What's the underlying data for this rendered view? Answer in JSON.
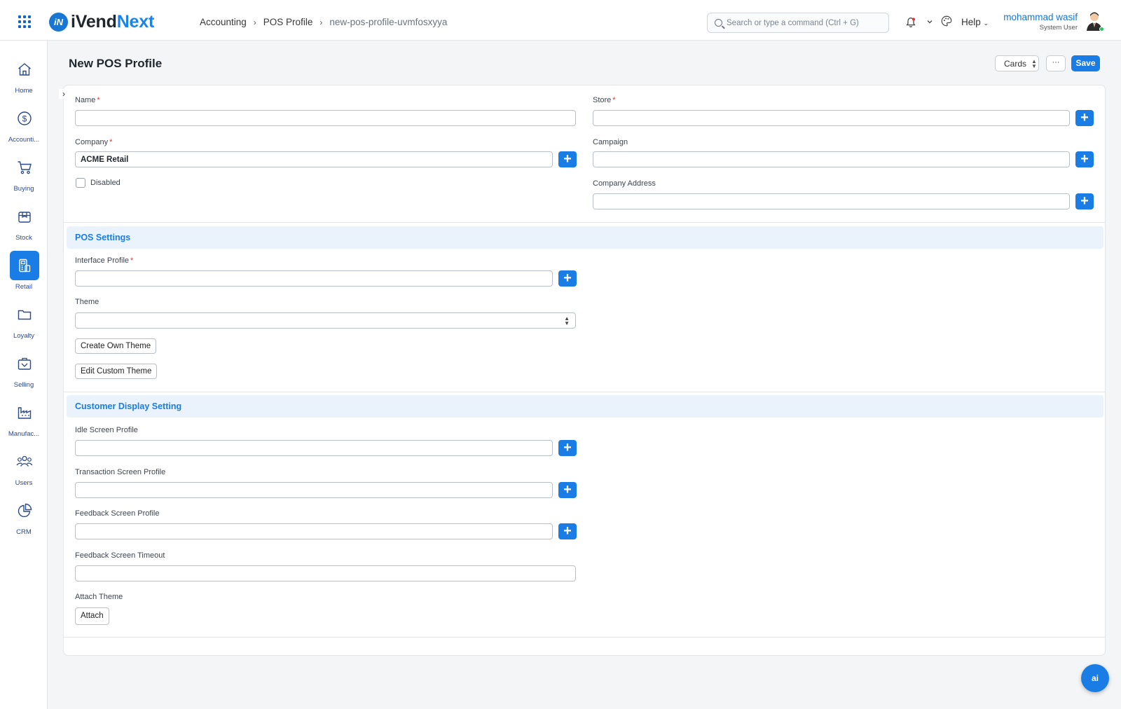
{
  "app": {
    "logo_part1": "iVend",
    "logo_part2": "Next",
    "logo_mark": "iN"
  },
  "breadcrumb": {
    "items": [
      "Accounting",
      "POS Profile",
      "new-pos-profile-uvmfosxyya"
    ]
  },
  "search": {
    "placeholder": "Search or type a command (Ctrl + G)"
  },
  "topbar": {
    "help_label": "Help"
  },
  "user": {
    "name": "mohammad wasif",
    "role": "System User"
  },
  "sidebar": {
    "items": [
      {
        "label": "Home",
        "icon": "home-icon"
      },
      {
        "label": "Accounti...",
        "icon": "dollar-icon"
      },
      {
        "label": "Buying",
        "icon": "cart-icon"
      },
      {
        "label": "Stock",
        "icon": "box-icon"
      },
      {
        "label": "Retail",
        "icon": "pos-icon",
        "active": true
      },
      {
        "label": "Loyalty",
        "icon": "folder-icon"
      },
      {
        "label": "Selling",
        "icon": "shop-icon"
      },
      {
        "label": "Manufac...",
        "icon": "factory-icon"
      },
      {
        "label": "Users",
        "icon": "users-icon"
      },
      {
        "label": "CRM",
        "icon": "pie-icon"
      }
    ]
  },
  "page": {
    "title": "New POS Profile",
    "view_label": "Cards",
    "more_label": "···",
    "save_label": "Save"
  },
  "form": {
    "name_label": "Name",
    "name_value": "",
    "store_label": "Store",
    "store_value": "",
    "company_label": "Company",
    "company_value": "ACME Retail",
    "campaign_label": "Campaign",
    "campaign_value": "",
    "disabled_label": "Disabled",
    "disabled_checked": false,
    "company_address_label": "Company Address",
    "company_address_value": ""
  },
  "pos_settings": {
    "title": "POS Settings",
    "interface_profile_label": "Interface Profile",
    "interface_profile_value": "",
    "theme_label": "Theme",
    "theme_value": "",
    "create_theme_label": "Create Own Theme",
    "edit_theme_label": "Edit Custom Theme"
  },
  "customer_display": {
    "title": "Customer Display Setting",
    "idle_label": "Idle Screen Profile",
    "idle_value": "",
    "transaction_label": "Transaction Screen Profile",
    "transaction_value": "",
    "feedback_label": "Feedback Screen Profile",
    "feedback_value": "",
    "timeout_label": "Feedback Screen Timeout",
    "timeout_value": "",
    "attach_theme_label": "Attach Theme",
    "attach_label": "Attach"
  },
  "fab": {
    "label": "ai"
  },
  "colors": {
    "accent": "#1a7de6",
    "section_bg": "#eaf3fc",
    "required": "#e03131"
  }
}
